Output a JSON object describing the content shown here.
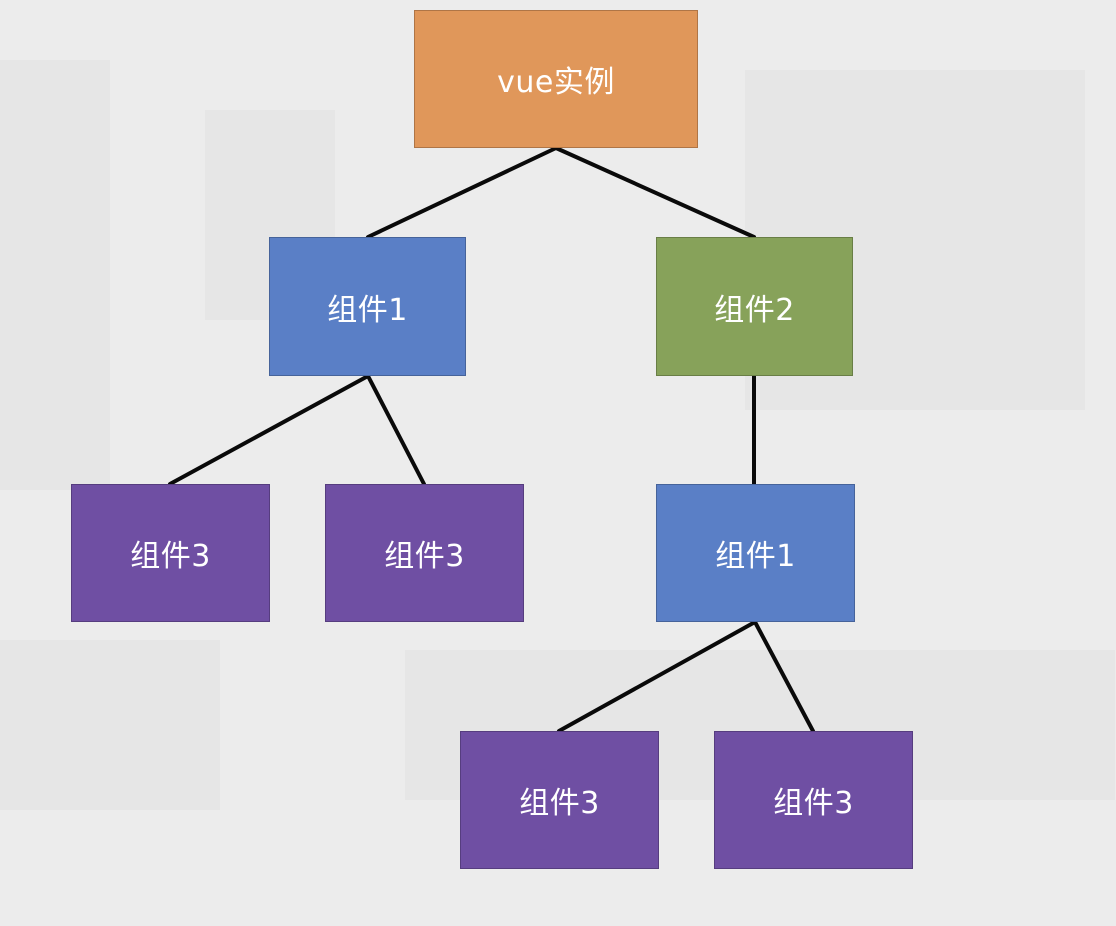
{
  "colors": {
    "background": "#ececec",
    "root": "#e0975a",
    "component_blue": "#5a7fc6",
    "component_green": "#87a25a",
    "component_purple": "#6f4fa3",
    "connector": "#0a0a0a"
  },
  "nodes": {
    "root": {
      "label": "vue实例",
      "color": "#e0975a"
    },
    "c1": {
      "label": "组件1",
      "color": "#5a7fc6"
    },
    "c2": {
      "label": "组件2",
      "color": "#87a25a"
    },
    "l3a": {
      "label": "组件3",
      "color": "#6f4fa3"
    },
    "l3b": {
      "label": "组件3",
      "color": "#6f4fa3"
    },
    "r1": {
      "label": "组件1",
      "color": "#5a7fc6"
    },
    "r3a": {
      "label": "组件3",
      "color": "#6f4fa3"
    },
    "r3b": {
      "label": "组件3",
      "color": "#6f4fa3"
    }
  },
  "edges": [
    {
      "from": "root",
      "to": "c1"
    },
    {
      "from": "root",
      "to": "c2"
    },
    {
      "from": "c1",
      "to": "l3a"
    },
    {
      "from": "c1",
      "to": "l3b"
    },
    {
      "from": "c2",
      "to": "r1"
    },
    {
      "from": "r1",
      "to": "r3a"
    },
    {
      "from": "r1",
      "to": "r3b"
    }
  ]
}
